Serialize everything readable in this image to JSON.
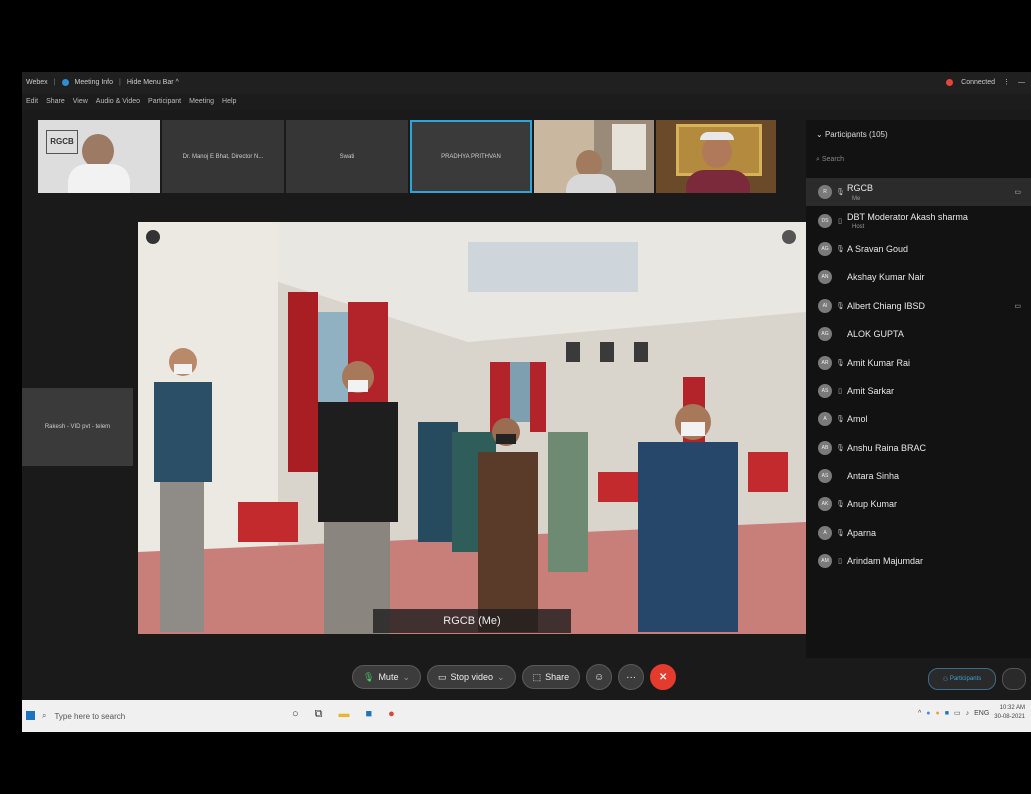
{
  "titlebar": {
    "app": "Webex",
    "meeting_info": "Meeting Info",
    "hide_menu": "Hide Menu Bar ^",
    "connected": "Connected",
    "connected_color": "#e8443a"
  },
  "menu": [
    "Edit",
    "Share",
    "View",
    "Audio & Video",
    "Participant",
    "Meeting",
    "Help"
  ],
  "filmstrip": [
    {
      "label": "",
      "type": "video"
    },
    {
      "label": "Dr. Manoj E Bhat, Director N...",
      "type": "name"
    },
    {
      "label": "Swati",
      "type": "name"
    },
    {
      "label": "PRADHYA PRITHVAN",
      "type": "name",
      "active": true
    },
    {
      "label": "",
      "type": "video"
    },
    {
      "label": "",
      "type": "video"
    }
  ],
  "side_tile": {
    "label": "Rakesh - VID pvt - telem"
  },
  "stage": {
    "name_tag": "RGCB  (Me)"
  },
  "controls": {
    "mute": "Mute",
    "stop_video": "Stop video",
    "share": "Share"
  },
  "participants": {
    "header": "Participants (105)",
    "search_placeholder": "Search",
    "rows": [
      {
        "initials": "R",
        "name": "RGCB",
        "sub": "Me",
        "selected": true,
        "cam": true
      },
      {
        "initials": "DS",
        "name": "DBT Moderator Akash sharma",
        "sub": "Host"
      },
      {
        "initials": "AG",
        "name": "A Sravan Goud"
      },
      {
        "initials": "AN",
        "name": "Akshay Kumar Nair"
      },
      {
        "initials": "AI",
        "name": "Albert Chiang IBSD",
        "cam": true
      },
      {
        "initials": "AG",
        "name": "ALOK GUPTA"
      },
      {
        "initials": "AR",
        "name": "Amit Kumar Rai"
      },
      {
        "initials": "AS",
        "name": "Amit Sarkar"
      },
      {
        "initials": "A",
        "name": "Amol"
      },
      {
        "initials": "AB",
        "name": "Anshu Raina BRAC"
      },
      {
        "initials": "AS",
        "name": "Antara Sinha"
      },
      {
        "initials": "AK",
        "name": "Anup Kumar"
      },
      {
        "initials": "A",
        "name": "Aparna"
      },
      {
        "initials": "AM",
        "name": "Arindam Majumdar"
      }
    ],
    "panel_button": "Participants"
  },
  "taskbar": {
    "search_placeholder": "Type here to search",
    "lang": "ENG",
    "time": "10:32 AM",
    "date": "30-08-2021"
  }
}
